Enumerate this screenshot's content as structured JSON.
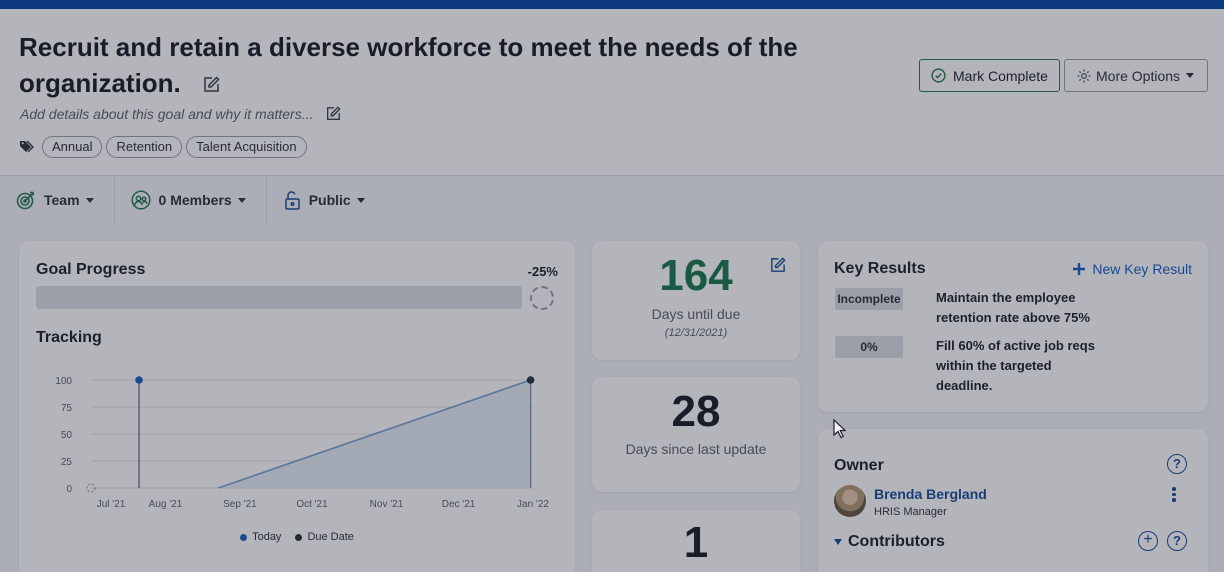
{
  "goal": {
    "title": "Recruit and retain a diverse workforce to meet the needs of the organization.",
    "details_placeholder": "Add details about this goal and why it matters...",
    "tags": [
      "Annual",
      "Retention",
      "Talent Acquisition"
    ]
  },
  "actions": {
    "mark_complete": "Mark Complete",
    "more_options": "More Options"
  },
  "toolbar": {
    "team": "Team",
    "members": "0 Members",
    "visibility": "Public"
  },
  "progress": {
    "title": "Goal Progress",
    "percent_label": "-25%",
    "fill_fraction": 0
  },
  "tracking": {
    "title": "Tracking",
    "legend_today": "Today",
    "legend_due": "Due Date"
  },
  "chart_data": {
    "type": "line",
    "x_ticks": [
      "Jul '21",
      "Aug '21",
      "Sep '21",
      "Oct '21",
      "Nov '21",
      "Dec '21",
      "Jan '22"
    ],
    "y_ticks": [
      0,
      25,
      50,
      75,
      100
    ],
    "ylim": [
      0,
      100
    ],
    "grid": true,
    "legend": "bottom",
    "series": [
      {
        "name": "Today",
        "color": "#1e5fc4",
        "points": [
          [
            "2021-07-21",
            100
          ],
          [
            "2021-07-21",
            0
          ]
        ]
      },
      {
        "name": "Due Date",
        "color": "#2c3340",
        "points": [
          [
            "2021-12-31",
            100
          ],
          [
            "2021-12-31",
            0
          ]
        ]
      },
      {
        "name": "",
        "color": "#7fa2cf",
        "points": [
          [
            "2021-08-23",
            0
          ],
          [
            "2021-12-31",
            100
          ]
        ]
      }
    ]
  },
  "stats": {
    "days_until_due": "164",
    "days_until_due_label": "Days until due",
    "due_date": "(12/31/2021)",
    "days_since_update": "28",
    "days_since_update_label": "Days since last update",
    "third_value": "1"
  },
  "key_results": {
    "title": "Key Results",
    "new_label": "New Key Result",
    "items": [
      {
        "status": "Incomplete",
        "text": "Maintain the employee retention rate above 75%"
      },
      {
        "status": "0%",
        "text": "Fill 60% of active job reqs within the targeted deadline."
      }
    ]
  },
  "owner": {
    "title": "Owner",
    "name": "Brenda Bergland",
    "role": "HRIS Manager",
    "contributors_label": "Contributors"
  },
  "colors": {
    "accent": "#0a47a9",
    "link": "#1e5fc4",
    "days_until_due": "#1f7a4f"
  }
}
